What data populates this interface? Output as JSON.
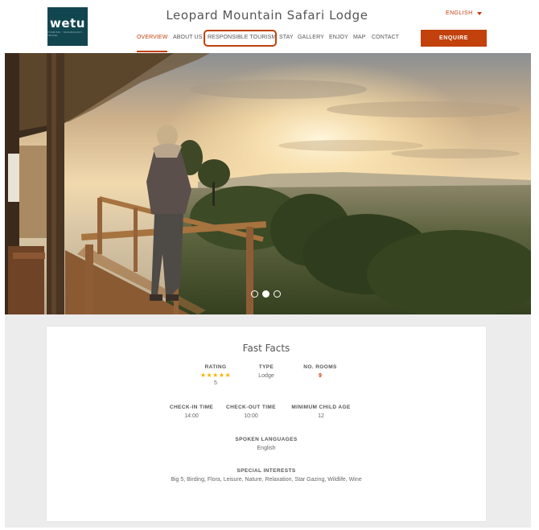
{
  "header": {
    "logo": {
      "word": "wetu",
      "tagline": "TOURISM · TECHNOLOGY · TRAVEL"
    },
    "site_title": "Leopard Mountain Safari Lodge",
    "language": "ENGLISH",
    "enquire_label": "ENQUIRE"
  },
  "nav": {
    "items": [
      {
        "label": "OVERVIEW",
        "active": true
      },
      {
        "label": "ABOUT US"
      },
      {
        "label": "RESPONSIBLE TOURISM",
        "highlighted": true
      },
      {
        "label": "STAY"
      },
      {
        "label": "GALLERY"
      },
      {
        "label": "ENJOY"
      },
      {
        "label": "MAP"
      },
      {
        "label": "CONTACT"
      }
    ]
  },
  "hero": {
    "description_icon": "landscape-photo",
    "carousel": {
      "slide_count": 3,
      "active_index": 1
    }
  },
  "fast_facts": {
    "title": "Fast Facts",
    "rating": {
      "label": "RATING",
      "stars": "★★★★★",
      "value": "5"
    },
    "type": {
      "label": "TYPE",
      "value": "Lodge"
    },
    "rooms": {
      "label": "NO. ROOMS",
      "value": "9"
    },
    "check_in": {
      "label": "CHECK-IN TIME",
      "value": "14:00"
    },
    "check_out": {
      "label": "CHECK-OUT TIME",
      "value": "10:00"
    },
    "min_child_age": {
      "label": "MINIMUM CHILD AGE",
      "value": "12"
    },
    "languages": {
      "label": "SPOKEN LANGUAGES",
      "value": "English"
    },
    "interests": {
      "label": "SPECIAL INTERESTS",
      "value": "Big 5, Birding, Flora, Leisure, Nature, Relaxation, Star Gazing, Wildlife, Wine"
    }
  },
  "colors": {
    "accent": "#c2410c",
    "logo_bg": "#12464f",
    "star": "#f4b400",
    "facts_bg": "#ececec"
  }
}
